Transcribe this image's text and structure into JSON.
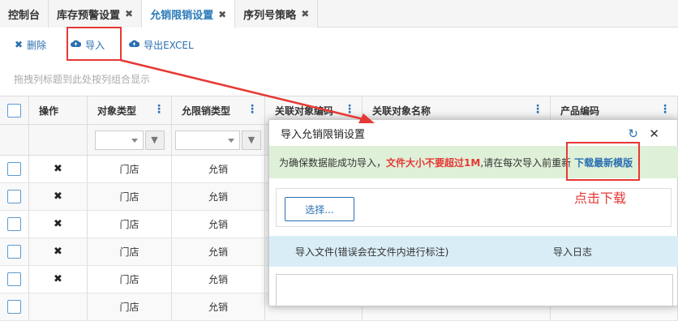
{
  "tabs": [
    {
      "label": "控制台",
      "close": ""
    },
    {
      "label": "库存预警设置",
      "close": "✖"
    },
    {
      "label": "允销限销设置",
      "close": "✖"
    },
    {
      "label": "序列号策略",
      "close": "✖"
    }
  ],
  "toolbar": {
    "delete_label": "删除",
    "import_label": "导入",
    "export_label": "导出EXCEL"
  },
  "group_hint": "拖拽列标题到此处按列组合显示",
  "columns": [
    "操作",
    "对象类型",
    "允限销类型",
    "关联对象编码",
    "关联对象名称",
    "产品编码"
  ],
  "rows": [
    {
      "op": "✖",
      "type": "门店",
      "sale": "允销"
    },
    {
      "op": "✖",
      "type": "门店",
      "sale": "允销"
    },
    {
      "op": "✖",
      "type": "门店",
      "sale": "允销"
    },
    {
      "op": "✖",
      "type": "门店",
      "sale": "允销"
    },
    {
      "op": "✖",
      "type": "门店",
      "sale": "允销"
    },
    {
      "op": "",
      "type": "门店",
      "sale": "允销"
    }
  ],
  "dialog": {
    "title": "导入允销限销设置",
    "notice_prefix": "为确保数据能成功导入，",
    "notice_warn": "文件大小不要超过1M",
    "notice_suffix": ",请在每次导入前重新",
    "download_link": "下载最新模版",
    "choose_label": "选择...",
    "col_file": "导入文件(错误会在文件内进行标注)",
    "col_log": "导入日志"
  },
  "annotation": {
    "click_download": "点击下载"
  },
  "colors": {
    "accent": "#2a6fb0",
    "highlight": "#e53935",
    "notice_bg": "#dff0d8",
    "table_head_bg": "#d9edf7"
  }
}
